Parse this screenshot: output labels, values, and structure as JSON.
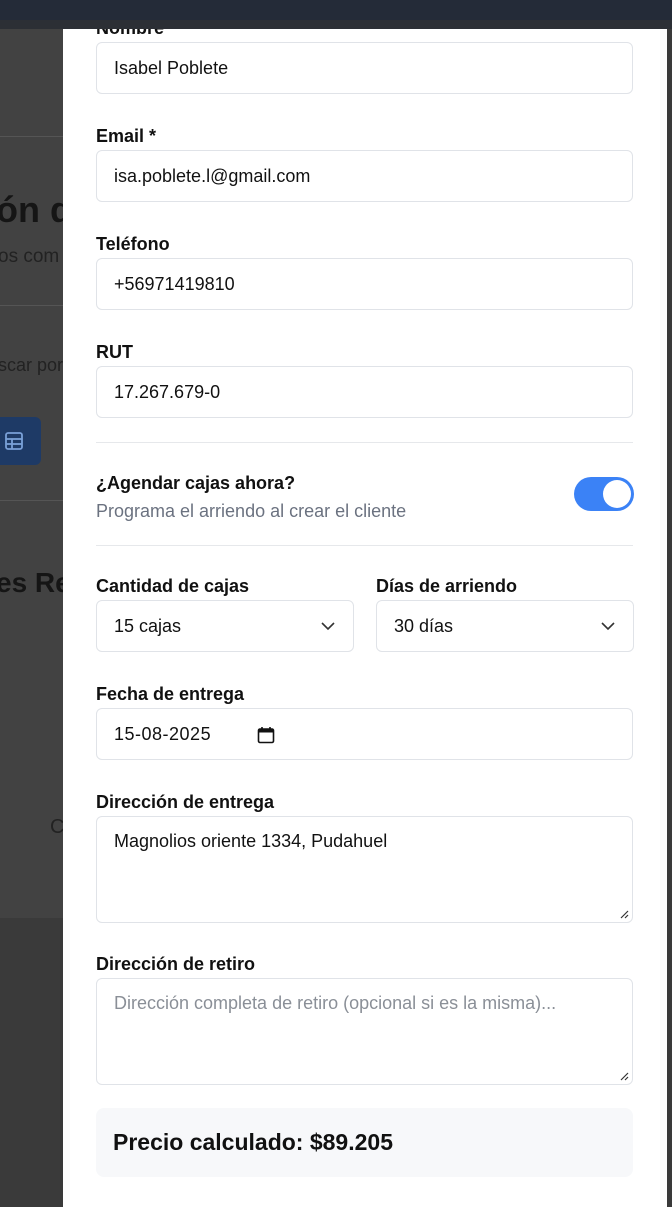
{
  "background": {
    "title_fragment": "ón d",
    "subtitle_fragment": "os com",
    "search_fragment": "scar por",
    "section_fragment": "es Re",
    "body_fragment": "C"
  },
  "form": {
    "nombre": {
      "label": "Nombre",
      "value": "Isabel Poblete"
    },
    "email": {
      "label": "Email *",
      "value": "isa.poblete.l@gmail.com"
    },
    "telefono": {
      "label": "Teléfono",
      "value": "+56971419810"
    },
    "rut": {
      "label": "RUT",
      "value": "17.267.679-0"
    },
    "agendar": {
      "title": "¿Agendar cajas ahora?",
      "description": "Programa el arriendo al crear el cliente",
      "enabled": true
    },
    "cantidad": {
      "label": "Cantidad de cajas",
      "selected": "15 cajas"
    },
    "dias": {
      "label": "Días de arriendo",
      "selected": "30 días"
    },
    "fecha": {
      "label": "Fecha de entrega",
      "value": "15-08-2025"
    },
    "direccion_entrega": {
      "label": "Dirección de entrega",
      "value": "Magnolios oriente 1334, Pudahuel"
    },
    "direccion_retiro": {
      "label": "Dirección de retiro",
      "placeholder": "Dirección completa de retiro (opcional si es la misma)..."
    },
    "precio": {
      "text": "Precio calculado: $89.205"
    }
  },
  "colors": {
    "accent": "#3b82f6",
    "overlay": "#3a3a3a",
    "topbar": "#242b38"
  },
  "icons": {
    "select": "chevron-down-icon",
    "date": "calendar-icon",
    "view": "table-icon"
  }
}
